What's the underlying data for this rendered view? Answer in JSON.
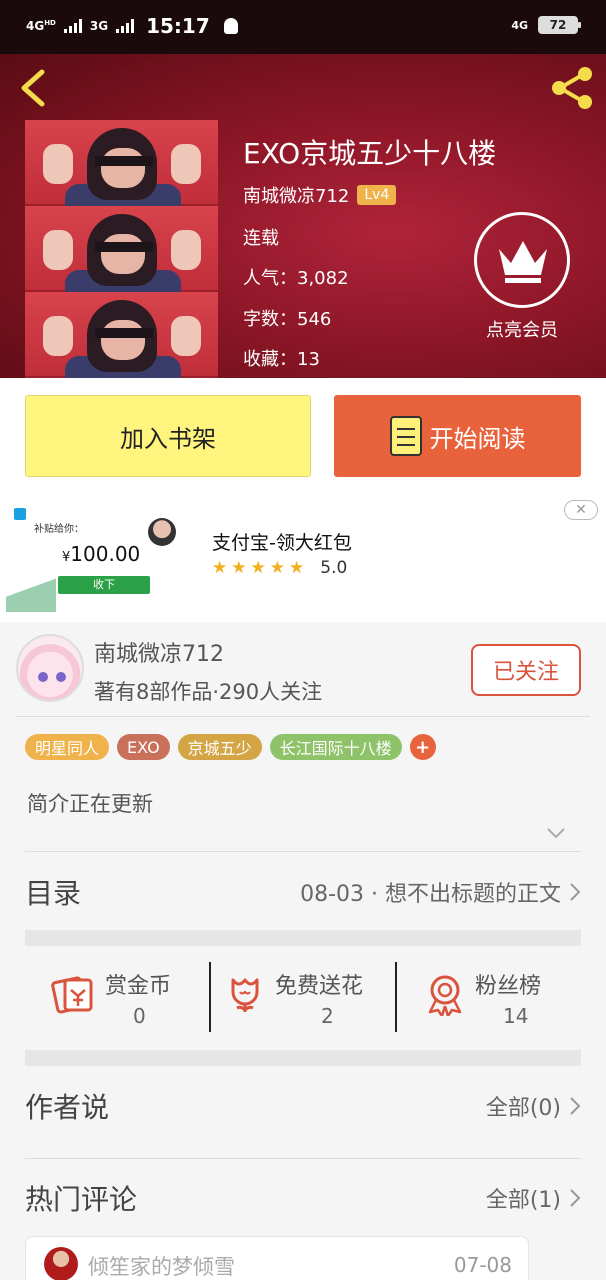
{
  "status_bar": {
    "network_1": "4G",
    "network_1_sup": "HD",
    "network_2": "3G",
    "time": "15:17",
    "network_right": "4G",
    "battery": "72"
  },
  "book": {
    "title": "EXO京城五少十八楼",
    "author": "南城微凉712",
    "level": "Lv4",
    "status": "连载",
    "popularity_label": "人气：",
    "popularity": "3,082",
    "words_label": "字数：",
    "words": "546",
    "favorites_label": "收藏：",
    "favorites": "13",
    "vip_label": "点亮会员"
  },
  "actions": {
    "add_shelf": "加入书架",
    "start_reading": "开始阅读"
  },
  "ad": {
    "subtitle": "补贴给你：",
    "currency": "¥",
    "amount": "100.00",
    "button": "收下",
    "title": "支付宝-领大红包",
    "rating": "5.0",
    "stars": 5
  },
  "author_card": {
    "name": "南城微凉712",
    "stats": "著有8部作品·290人关注",
    "follow": "已关注"
  },
  "tags": [
    {
      "label": "明星同人",
      "color": "#f0b24a"
    },
    {
      "label": "EXO",
      "color": "#c9705a"
    },
    {
      "label": "京城五少",
      "color": "#d4a545"
    },
    {
      "label": "长江国际十八楼",
      "color": "#8fc36a"
    }
  ],
  "intro": "简介正在更新",
  "catalog": {
    "title": "目录",
    "latest": "08-03 · 想不出标题的正文"
  },
  "stats": [
    {
      "label": "赏金币",
      "value": "0",
      "icon": "red-envelope-icon"
    },
    {
      "label": "免费送花",
      "value": "2",
      "icon": "flower-icon"
    },
    {
      "label": "粉丝榜",
      "value": "14",
      "icon": "medal-icon"
    }
  ],
  "author_says": {
    "title": "作者说",
    "all": "全部(0)"
  },
  "hot_comments": {
    "title": "热门评论",
    "all": "全部(1)"
  },
  "comments": [
    {
      "user": "倾笙家的梦倾雪",
      "date": "07-08"
    }
  ],
  "colors": {
    "header": "#8c1626",
    "accent": "#e8633b",
    "shelf_button": "#fff57e",
    "follow": "#d9533d"
  }
}
